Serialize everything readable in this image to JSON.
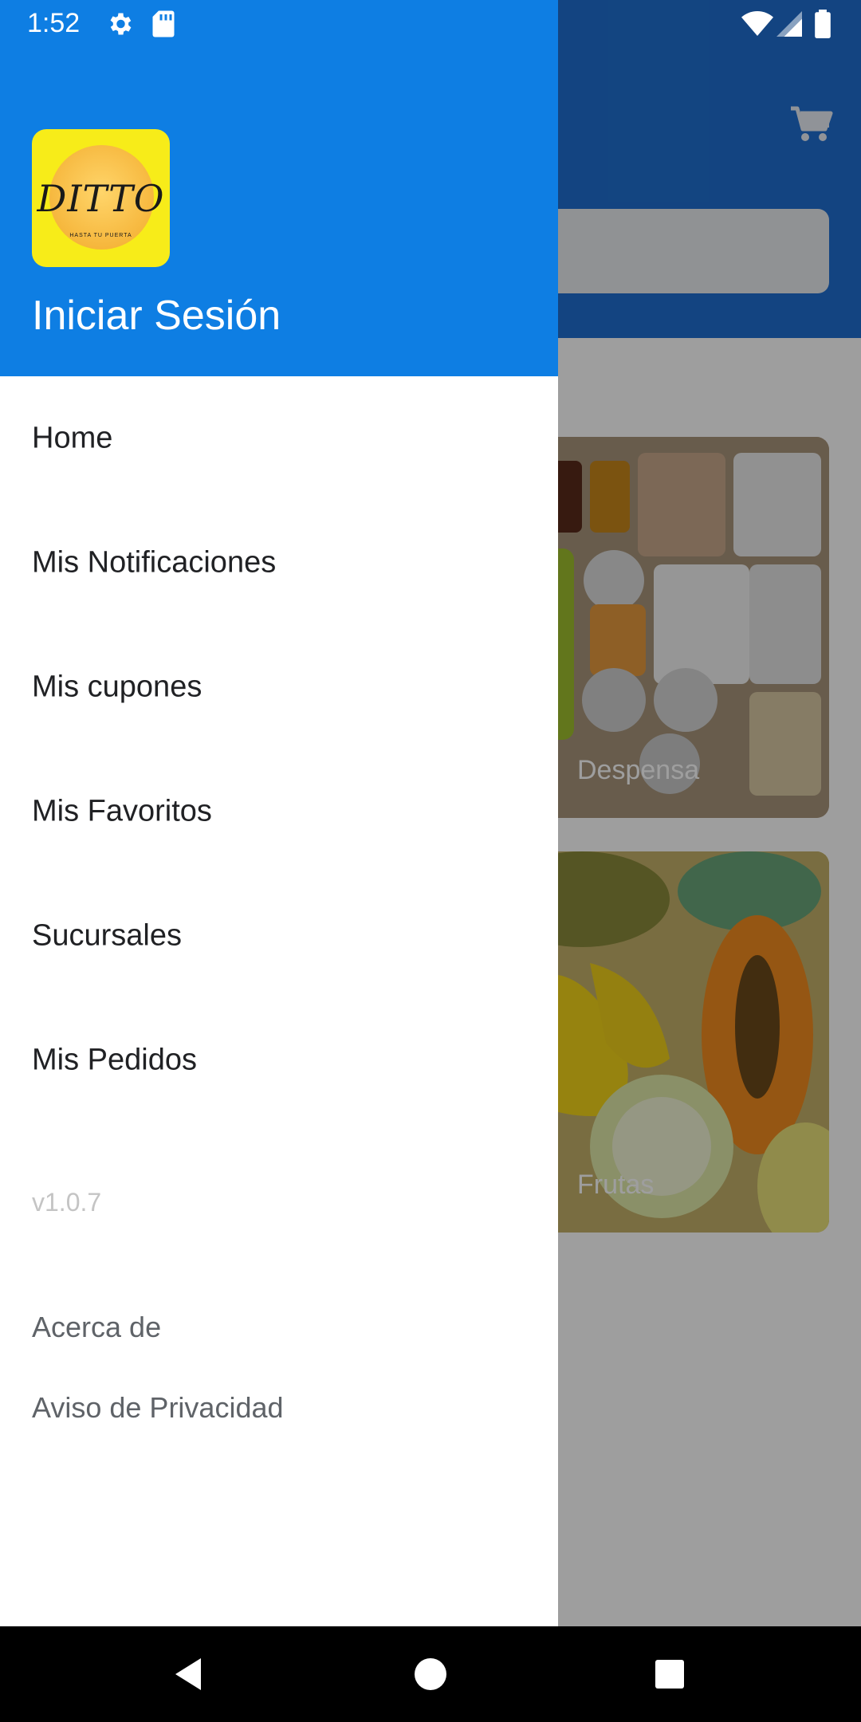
{
  "status_bar": {
    "time": "1:52",
    "left_icons": [
      "gear-icon",
      "sd-card-icon"
    ],
    "right_icons": [
      "wifi-icon",
      "signal-icon",
      "battery-icon"
    ]
  },
  "drawer": {
    "logo_text": "DITTO",
    "logo_subtext": "HASTA TU PUERTA",
    "login_label": "Iniciar Sesión",
    "menu_items": [
      {
        "label": "Home"
      },
      {
        "label": "Mis Notificaciones"
      },
      {
        "label": "Mis cupones"
      },
      {
        "label": "Mis Favoritos"
      },
      {
        "label": "Sucursales"
      },
      {
        "label": "Mis Pedidos"
      }
    ],
    "version": "v1.0.7",
    "footer_links": [
      {
        "label": "Acerca de"
      },
      {
        "label": "Aviso de Privacidad"
      }
    ]
  },
  "background": {
    "cart_icon": "shopping-cart-icon",
    "categories": [
      {
        "label": "Despensa"
      },
      {
        "label": "Frutas"
      }
    ]
  },
  "navigation_bar": {
    "buttons": [
      "back-icon",
      "home-icon",
      "recents-icon"
    ]
  },
  "colors": {
    "drawer_header": "#0e7ee3",
    "app_header": "#1f6fd1",
    "scrim": "rgba(0,0,0,0.38)"
  }
}
